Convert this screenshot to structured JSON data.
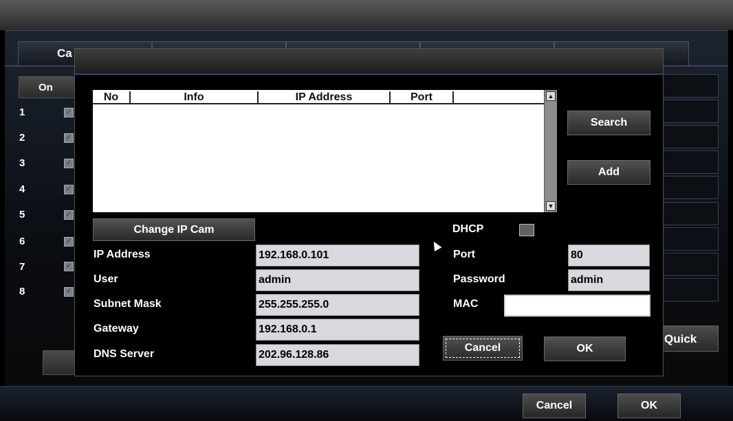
{
  "background": {
    "tab_label": "Ca",
    "on_button": "On",
    "rows": [
      "1",
      "2",
      "3",
      "4",
      "5",
      "6",
      "7",
      "8"
    ],
    "quick_button": "Quick",
    "bottom_cancel": "Cancel",
    "bottom_ok": "OK"
  },
  "dialog": {
    "list": {
      "columns": [
        "No",
        "Info",
        "IP Address",
        "Port"
      ]
    },
    "search_button": "Search",
    "add_button": "Add",
    "change_ip_cam_button": "Change IP Cam",
    "dhcp_label": "DHCP",
    "dhcp_checked": false,
    "fields": {
      "ip_address": {
        "label": "IP Address",
        "value": "192.168.0.101"
      },
      "user": {
        "label": "User",
        "value": "admin"
      },
      "subnet_mask": {
        "label": "Subnet Mask",
        "value": "255.255.255.0"
      },
      "gateway": {
        "label": "Gateway",
        "value": "192.168.0.1"
      },
      "dns_server": {
        "label": "DNS Server",
        "value": "202.96.128.86"
      },
      "port": {
        "label": "Port",
        "value": "80"
      },
      "password": {
        "label": "Password",
        "value": "admin"
      },
      "mac": {
        "label": "MAC",
        "value": ""
      }
    },
    "cancel_button": "Cancel",
    "ok_button": "OK"
  },
  "colors": {
    "accent_line": "#2c4a78",
    "input_bg": "#d8d8de"
  }
}
